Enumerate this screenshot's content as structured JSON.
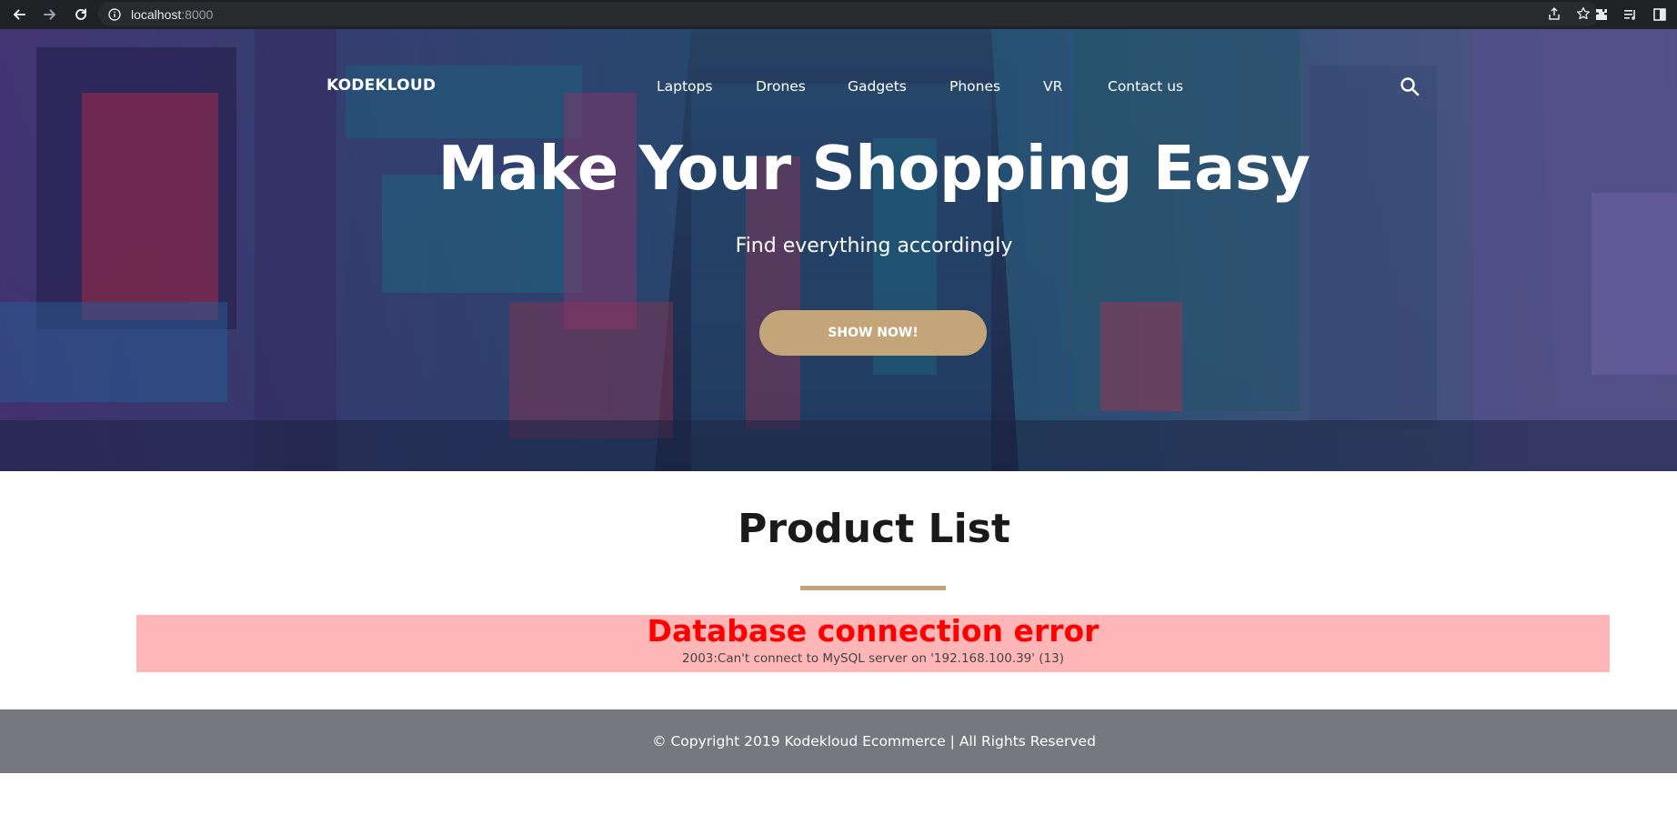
{
  "browser": {
    "url_host": "localhost",
    "url_port": ":8000"
  },
  "site": {
    "logo": "KODEKLOUD",
    "nav": [
      {
        "label": "Laptops"
      },
      {
        "label": "Drones"
      },
      {
        "label": "Gadgets"
      },
      {
        "label": "Phones"
      },
      {
        "label": "VR"
      },
      {
        "label": "Contact us"
      }
    ]
  },
  "hero": {
    "title": "Make Your Shopping Easy",
    "subtitle": "Find everything accordingly",
    "cta_label": "SHOW NOW!"
  },
  "products": {
    "title": "Product List",
    "error_title": "Database connection error",
    "error_message": "2003:Can't connect to MySQL server on '192.168.100.39' (13)"
  },
  "footer": {
    "text": "© Copyright 2019 Kodekloud Ecommerce | All Rights Reserved"
  },
  "colors": {
    "accent": "#c4a57a",
    "error_bg": "#ffb6b6",
    "error_text": "#ff0000",
    "footer_bg": "#76787f"
  }
}
